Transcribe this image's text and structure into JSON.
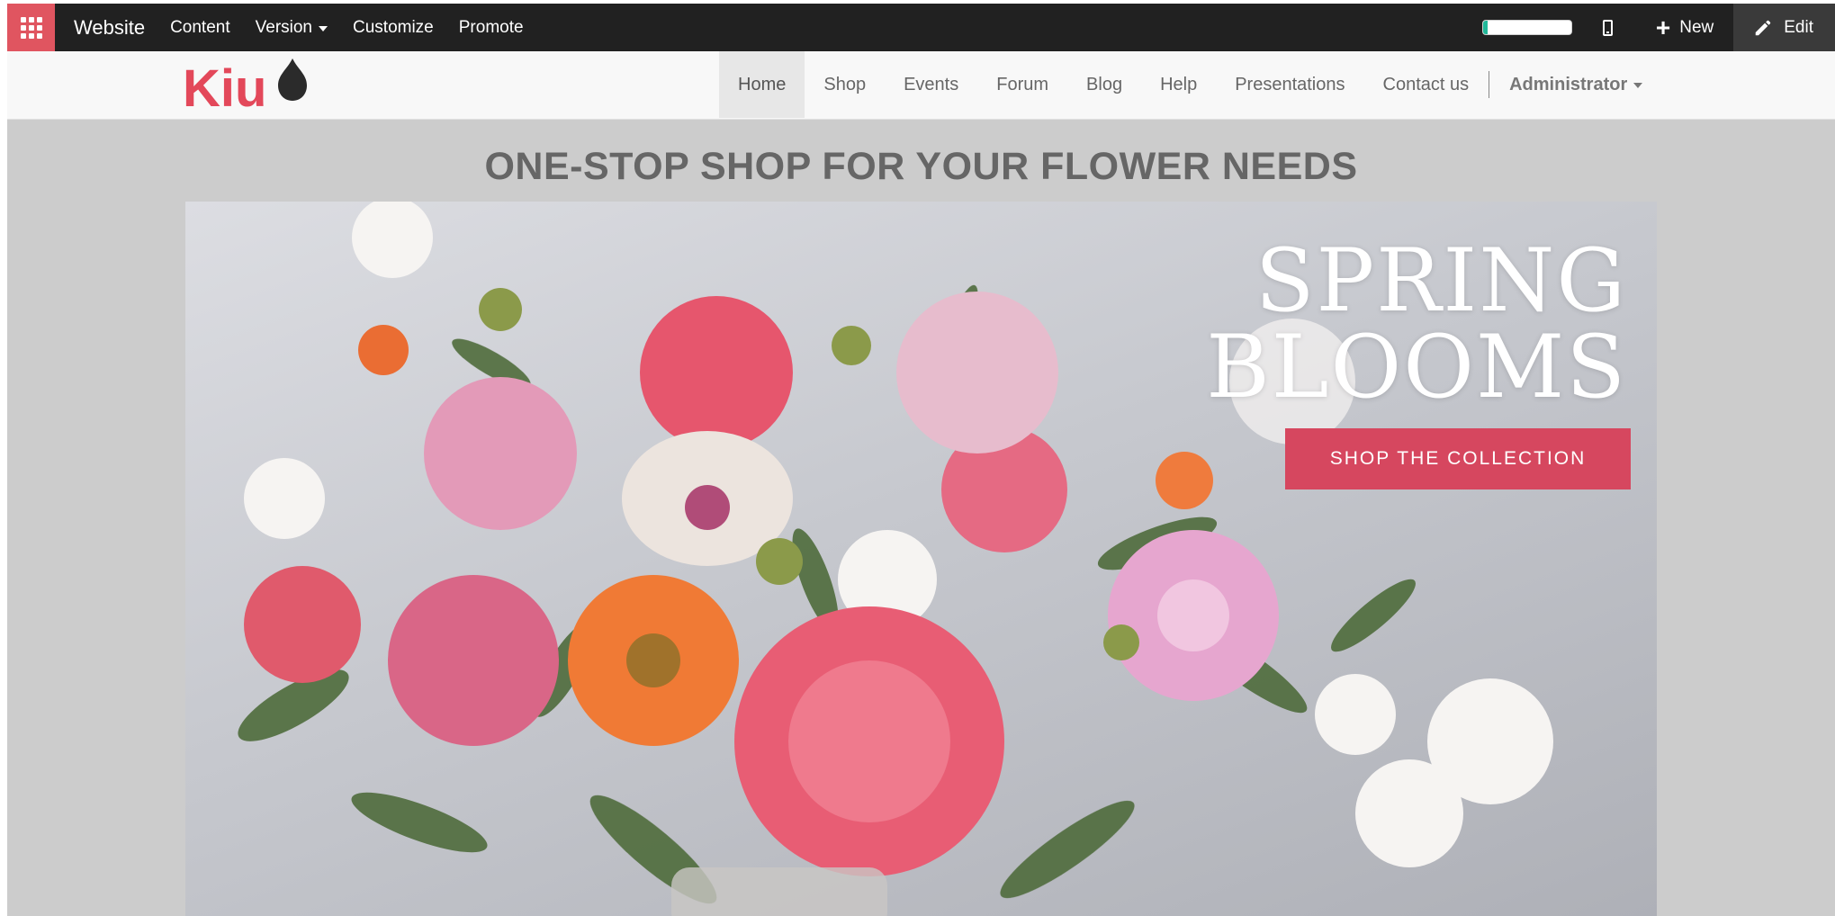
{
  "topbar": {
    "apps_icon": "grid-apps-icon",
    "brand": "Website",
    "menu": [
      "Content",
      "Version",
      "Customize",
      "Promote"
    ],
    "progress": 0.05,
    "progress_color": "#21b799",
    "new_label": "New",
    "edit_label": "Edit"
  },
  "navbar": {
    "logo_text": "Kiu",
    "links": [
      "Home",
      "Shop",
      "Events",
      "Forum",
      "Blog",
      "Help",
      "Presentations",
      "Contact us"
    ],
    "active": "Home",
    "user": "Administrator"
  },
  "main": {
    "headline": "ONE-STOP SHOP FOR YOUR FLOWER NEEDS",
    "hero": {
      "title_line1": "SPRING",
      "title_line2": "BLOOMS",
      "cta": "SHOP THE COLLECTION",
      "cta_color": "#d6475f"
    }
  },
  "colors": {
    "topbar_bg": "#212121",
    "apps_bg": "#e05560",
    "page_bg": "#cccccc",
    "navbar_bg": "#f8f8f8"
  }
}
